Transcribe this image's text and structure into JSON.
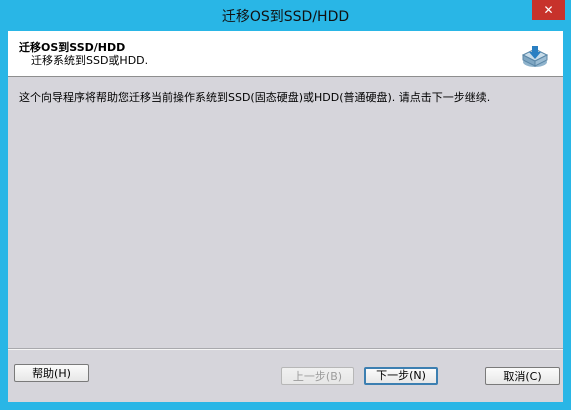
{
  "window": {
    "title": "迁移OS到SSD/HDD",
    "close_glyph": "✕"
  },
  "header": {
    "title": "迁移OS到SSD/HDD",
    "subtitle": "迁移系统到SSD或HDD.",
    "icon": "disk-migrate-icon"
  },
  "body": {
    "description": "这个向导程序将帮助您迁移当前操作系统到SSD(固态硬盘)或HDD(普通硬盘). 请点击下一步继续."
  },
  "buttons": {
    "help": "帮助(H)",
    "back": "上一步(B)",
    "next": "下一步(N)",
    "cancel": "取消(C)"
  },
  "colors": {
    "titlebar": "#29b6e6",
    "close": "#c7322b",
    "client_bg": "#d6d5db"
  }
}
